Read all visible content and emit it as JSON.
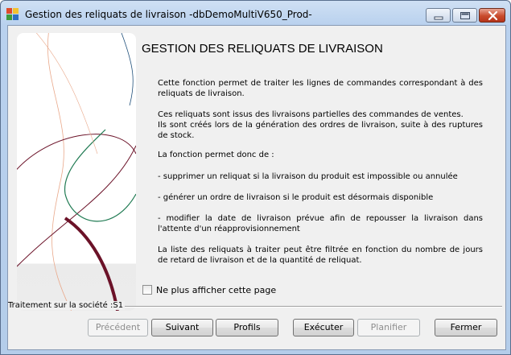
{
  "window": {
    "title": "Gestion des reliquats de livraison -dbDemoMultiV650_Prod-",
    "icon": "app-multicolor-icon",
    "controls": [
      "minimize-icon",
      "maximize-icon",
      "close-icon"
    ]
  },
  "main": {
    "heading": "GESTION DES RELIQUATS DE LIVRAISON",
    "paragraphs": [
      "Cette fonction permet de traiter les lignes de commandes correspondant à des reliquats de livraison.",
      "Ces reliquats sont issus des livraisons partielles des commandes de ventes.",
      "Ils sont créés lors de la génération des ordres de livraison, suite à des ruptures de stock.",
      "La fonction permet donc de :",
      "- supprimer un reliquat si la livraison du produit est impossible ou annulée",
      "- générer un ordre de livraison si le produit est désormais disponible",
      "- modifier la date de livraison prévue afin de repousser la livraison dans l'attente d'un réapprovisionnement",
      "La liste des reliquats à traiter peut être filtrée en fonction du nombre de jours de retard de livraison et de la quantité de reliquat."
    ],
    "checkbox_label": "Ne plus afficher cette page",
    "checkbox_checked": false
  },
  "footer": {
    "company_label": "Traitement sur la société :S1",
    "buttons": {
      "previous": "Précédent",
      "next": "Suivant",
      "profiles": "Profils",
      "execute": "Exécuter",
      "schedule": "Planifier",
      "close": "Fermer"
    }
  },
  "colors": {
    "title_bar": "#b9d1ee",
    "close_button": "#c94b2c",
    "art_wine": "#6b1228",
    "art_green": "#1f7a52"
  }
}
